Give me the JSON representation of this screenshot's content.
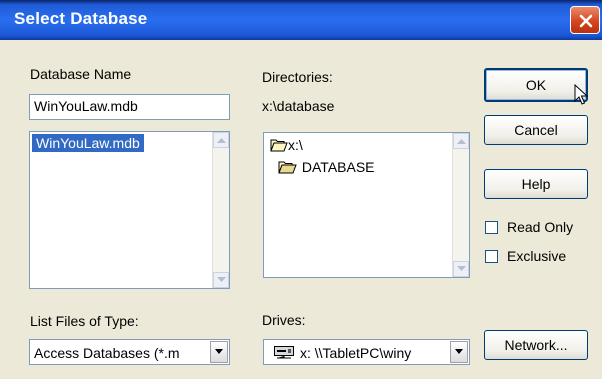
{
  "window": {
    "title": "Select Database"
  },
  "database_name": {
    "label": "Database Name",
    "value": "WinYouLaw.mdb",
    "files": [
      "WinYouLaw.mdb"
    ]
  },
  "directories": {
    "label": "Directories:",
    "current_path": "x:\\database",
    "tree": [
      "x:\\",
      "DATABASE"
    ]
  },
  "file_type": {
    "label": "List Files of Type:",
    "selected": "Access Databases (*.m"
  },
  "drives": {
    "label": "Drives:",
    "selected": "x: \\\\TabletPC\\winy"
  },
  "buttons": {
    "ok": "OK",
    "cancel": "Cancel",
    "help": "Help",
    "network": "Network..."
  },
  "options": {
    "read_only": "Read Only",
    "exclusive": "Exclusive"
  },
  "icons": {
    "close": "close-icon",
    "folder_open": "folder-open-icon",
    "network_drive": "network-drive-icon"
  }
}
